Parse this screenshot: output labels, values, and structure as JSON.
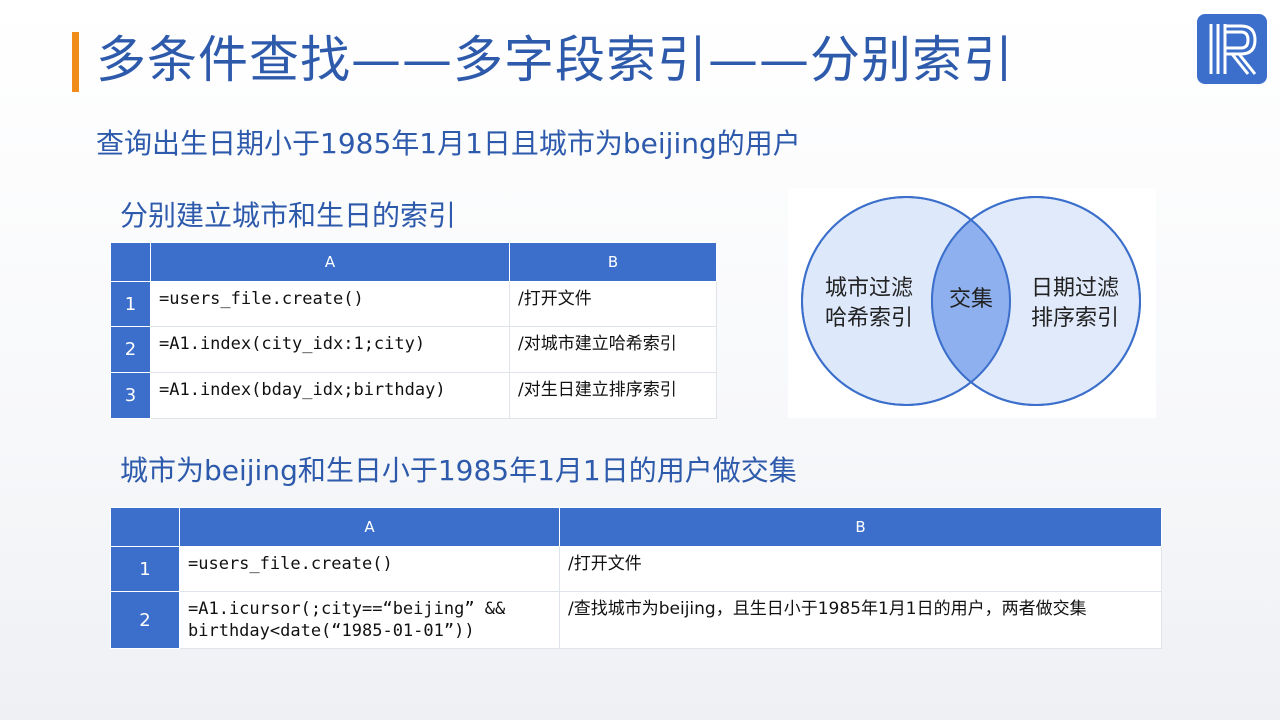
{
  "slide": {
    "title": "多条件查找——多字段索引——分别索引",
    "subtitle": "查询出生日期小于1985年1月1日且城市为beijing的用户",
    "logo_letter": "R",
    "accent_color": "#f08c1a",
    "brand_color": "#3b6fcb"
  },
  "section1": {
    "heading": "分别建立城市和生日的索引",
    "columns": [
      "A",
      "B"
    ],
    "rows": [
      {
        "num": "1",
        "a": "=users_file.create()",
        "b": "/打开文件"
      },
      {
        "num": "2",
        "a": "=A1.index(city_idx:1;city)",
        "b": "/对城市建立哈希索引"
      },
      {
        "num": "3",
        "a": "=A1.index(bday_idx;birthday)",
        "b": "/对生日建立排序索引"
      }
    ]
  },
  "venn": {
    "left_line1": "城市过滤",
    "left_line2": "哈希索引",
    "center": "交集",
    "right_line1": "日期过滤",
    "right_line2": "排序索引"
  },
  "section2": {
    "heading": "城市为beijing和生日小于1985年1月1日的用户做交集",
    "columns": [
      "A",
      "B"
    ],
    "rows": [
      {
        "num": "1",
        "a_line1": "=users_file.create()",
        "a_line2": "",
        "b": "/打开文件"
      },
      {
        "num": "2",
        "a_line1": "=A1.icursor(;city==“beijing” &&",
        "a_line2": "birthday<date(“1985-01-01”))",
        "b": "/查找城市为beijing，且生日小于1985年1月1日的用户，两者做交集"
      }
    ]
  }
}
